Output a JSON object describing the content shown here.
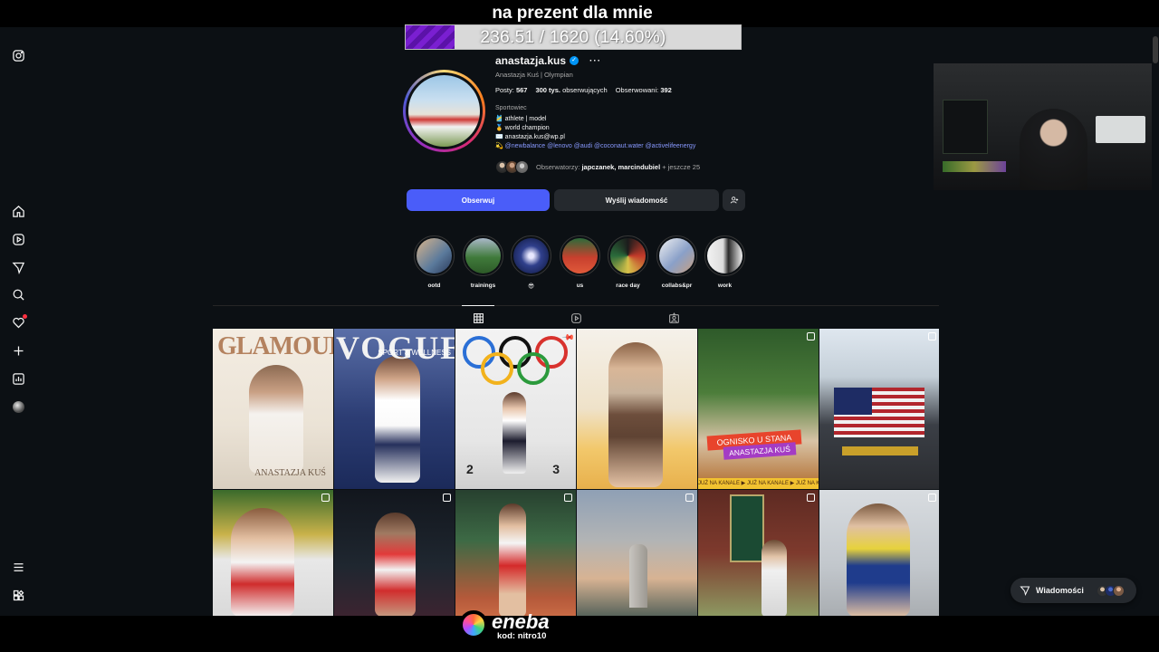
{
  "overlay": {
    "donation_title": "na prezent dla mnie",
    "donation_progress_text": "236.51 / 1620 (14.60%)",
    "donation_progress_fraction": 0.146,
    "bar_color": "#7a1fd1"
  },
  "sidebar": {
    "items": [
      {
        "icon": "instagram-logo-icon"
      },
      {
        "icon": "home-icon"
      },
      {
        "icon": "reels-icon"
      },
      {
        "icon": "explore-icon"
      },
      {
        "icon": "search-icon"
      },
      {
        "icon": "heart-icon"
      },
      {
        "icon": "create-plus-icon"
      },
      {
        "icon": "dashboard-icon"
      },
      {
        "icon": "profile-avatar-icon"
      },
      {
        "icon": "menu-icon"
      },
      {
        "icon": "also-from-meta-icon"
      }
    ]
  },
  "profile": {
    "username": "anastazja.kus",
    "verified": true,
    "full_name": "Anastazja Kuś | Olympian",
    "stats": {
      "posts_label": "Posty:",
      "posts_value": "567",
      "followers_value": "300 tys.",
      "followers_label": "obserwujących",
      "following_label": "Obserwowani:",
      "following_value": "392"
    },
    "category": "Sportowiec",
    "bio_lines": [
      "🎽 athlete | model",
      "🥇 world champion",
      "✉️ anastazja.kus@wp.pl"
    ],
    "bio_mentions_prefix": "💫",
    "bio_mentions": "@newbalance @lenovo @audi @coconaut.water @activelifeenergy",
    "followed_by_label": "Obserwatorzy:",
    "followed_by_names": "japczanek, marcindubiel",
    "followed_by_more": "+ jeszcze 25"
  },
  "actions": {
    "follow": "Obserwuj",
    "message": "Wyślij wiadomość",
    "suggest_icon": "add-person-icon"
  },
  "highlights": [
    {
      "label": "ootd"
    },
    {
      "label": "trainings"
    },
    {
      "label": "😎"
    },
    {
      "label": "us"
    },
    {
      "label": "race day"
    },
    {
      "label": "collabs&pr"
    },
    {
      "label": "work"
    }
  ],
  "tabs": [
    {
      "icon": "grid-icon",
      "active": true
    },
    {
      "icon": "reels-tab-icon",
      "active": false
    },
    {
      "icon": "tagged-icon",
      "active": false
    }
  ],
  "posts": {
    "p1_title": "GLAMOUR",
    "p1_sub": "ANASTAZJA KUŚ",
    "p2_title": "VOGUE",
    "p2_sub": "SPORT & WELLNESS",
    "p3_left": "2",
    "p3_right": "3",
    "p5_banner": "OGNISKO U STANA",
    "p5_guest": "ANASTAZJA KUŚ",
    "p5_strip": "JUŻ NA KANALE ▶ JUŻ NA KANALE ▶ JUŻ NA KANALE ▶"
  },
  "messages": {
    "label": "Wiadomości"
  },
  "sponsor": {
    "name": "eneba",
    "code": "kod: nitro10"
  }
}
